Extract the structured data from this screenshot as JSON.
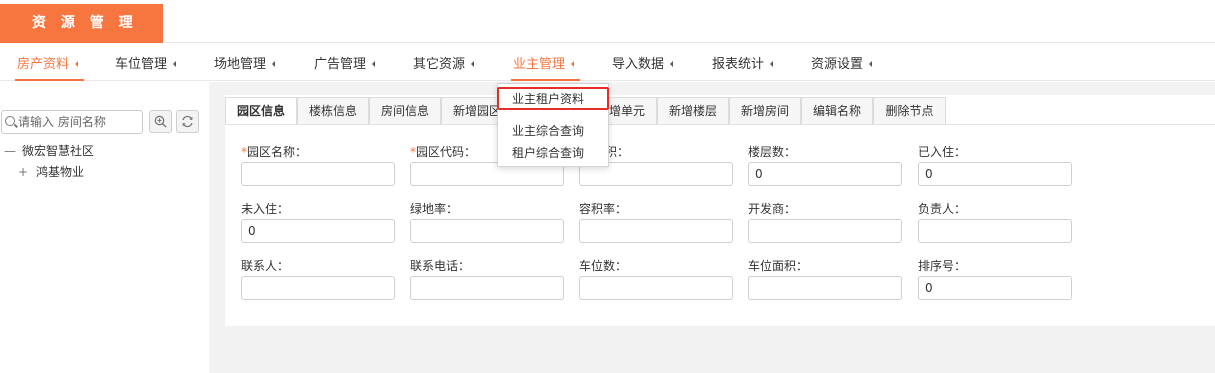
{
  "brand": {
    "title": "资 源 管 理"
  },
  "nav": {
    "items": [
      {
        "label": "房产资料",
        "active": true
      },
      {
        "label": "车位管理"
      },
      {
        "label": "场地管理"
      },
      {
        "label": "广告管理"
      },
      {
        "label": "其它资源"
      },
      {
        "label": "业主管理",
        "highlighted": true
      },
      {
        "label": "导入数据"
      },
      {
        "label": "报表统计"
      },
      {
        "label": "资源设置"
      }
    ]
  },
  "dropdown": {
    "items": [
      {
        "label": "业主租户资料",
        "highlighted": true
      },
      {
        "label": "业主综合查询"
      },
      {
        "label": "租户综合查询"
      }
    ]
  },
  "sidebar": {
    "search_placeholder": "请输入 房间名称",
    "tree": [
      {
        "symbol": "—",
        "label": "微宏智慧社区"
      },
      {
        "symbol": "+",
        "label": "鸿基物业"
      }
    ]
  },
  "tabs": [
    {
      "label": "园区信息",
      "active": true
    },
    {
      "label": "楼栋信息"
    },
    {
      "label": "房间信息"
    },
    {
      "label": "新增园区"
    },
    {
      "label": "新增单元"
    },
    {
      "label": "新增楼层"
    },
    {
      "label": "新增房间"
    },
    {
      "label": "编辑名称"
    },
    {
      "label": "删除节点"
    }
  ],
  "form": {
    "fields": [
      {
        "label": "园区名称：",
        "required": true,
        "value": ""
      },
      {
        "label": "园区代码：",
        "required": true,
        "value": ""
      },
      {
        "label": "面积：",
        "value": ""
      },
      {
        "label": "楼层数：",
        "value": "0"
      },
      {
        "label": "已入住：",
        "value": "0"
      },
      {
        "label": "未入住：",
        "value": "0"
      },
      {
        "label": "绿地率：",
        "value": ""
      },
      {
        "label": "容积率：",
        "value": ""
      },
      {
        "label": "开发商：",
        "value": ""
      },
      {
        "label": "负责人：",
        "value": ""
      },
      {
        "label": "联系人：",
        "value": ""
      },
      {
        "label": "联系电话：",
        "value": ""
      },
      {
        "label": "车位数：",
        "value": ""
      },
      {
        "label": "车位面积：",
        "value": ""
      },
      {
        "label": "排序号：",
        "value": "0"
      }
    ]
  },
  "colors": {
    "accent": "#f7753f",
    "highlight": "#e52e25"
  }
}
